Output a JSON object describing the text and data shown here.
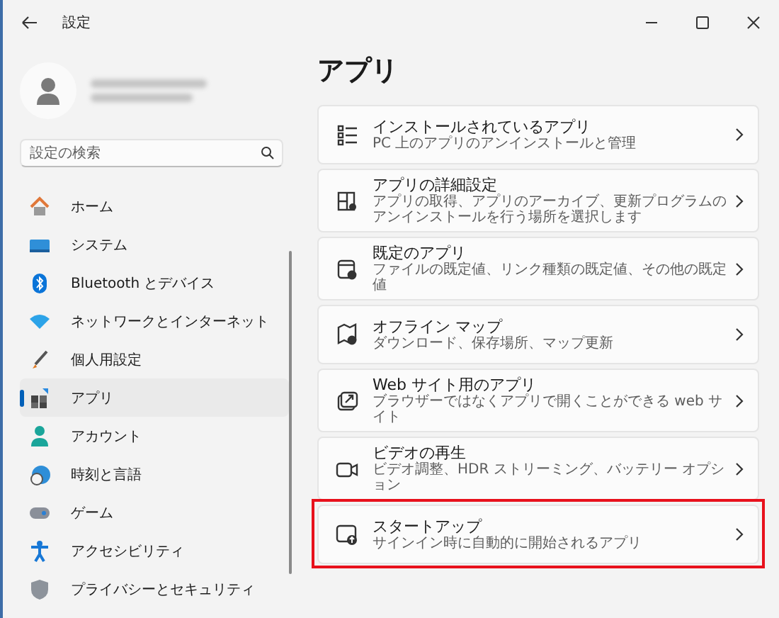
{
  "window": {
    "title": "設定"
  },
  "sidebar": {
    "search": {
      "placeholder": "設定の検索"
    },
    "items": [
      {
        "label": "ホーム",
        "selected": false
      },
      {
        "label": "システム",
        "selected": false
      },
      {
        "label": "Bluetooth とデバイス",
        "selected": false
      },
      {
        "label": "ネットワークとインターネット",
        "selected": false
      },
      {
        "label": "個人用設定",
        "selected": false
      },
      {
        "label": "アプリ",
        "selected": true
      },
      {
        "label": "アカウント",
        "selected": false
      },
      {
        "label": "時刻と言語",
        "selected": false
      },
      {
        "label": "ゲーム",
        "selected": false
      },
      {
        "label": "アクセシビリティ",
        "selected": false
      },
      {
        "label": "プライバシーとセキュリティ",
        "selected": false
      }
    ]
  },
  "page": {
    "heading": "アプリ",
    "cards": [
      {
        "title": "インストールされているアプリ",
        "subtitle": "PC 上のアプリのアンインストールと管理",
        "highlighted": false
      },
      {
        "title": "アプリの詳細設定",
        "subtitle": "アプリの取得、アプリのアーカイブ、更新プログラムのアンインストールを行う場所を選択します",
        "highlighted": false
      },
      {
        "title": "既定のアプリ",
        "subtitle": "ファイルの既定値、リンク種類の既定値、その他の既定値",
        "highlighted": false
      },
      {
        "title": "オフライン マップ",
        "subtitle": "ダウンロード、保存場所、マップ更新",
        "highlighted": false
      },
      {
        "title": "Web サイト用のアプリ",
        "subtitle": "ブラウザーではなくアプリで開くことができる web サイト",
        "highlighted": false
      },
      {
        "title": "ビデオの再生",
        "subtitle": "ビデオ調整、HDR ストリーミング、バッテリー オプション",
        "highlighted": false
      },
      {
        "title": "スタートアップ",
        "subtitle": "サインイン時に自動的に開始されるアプリ",
        "highlighted": true
      }
    ]
  }
}
